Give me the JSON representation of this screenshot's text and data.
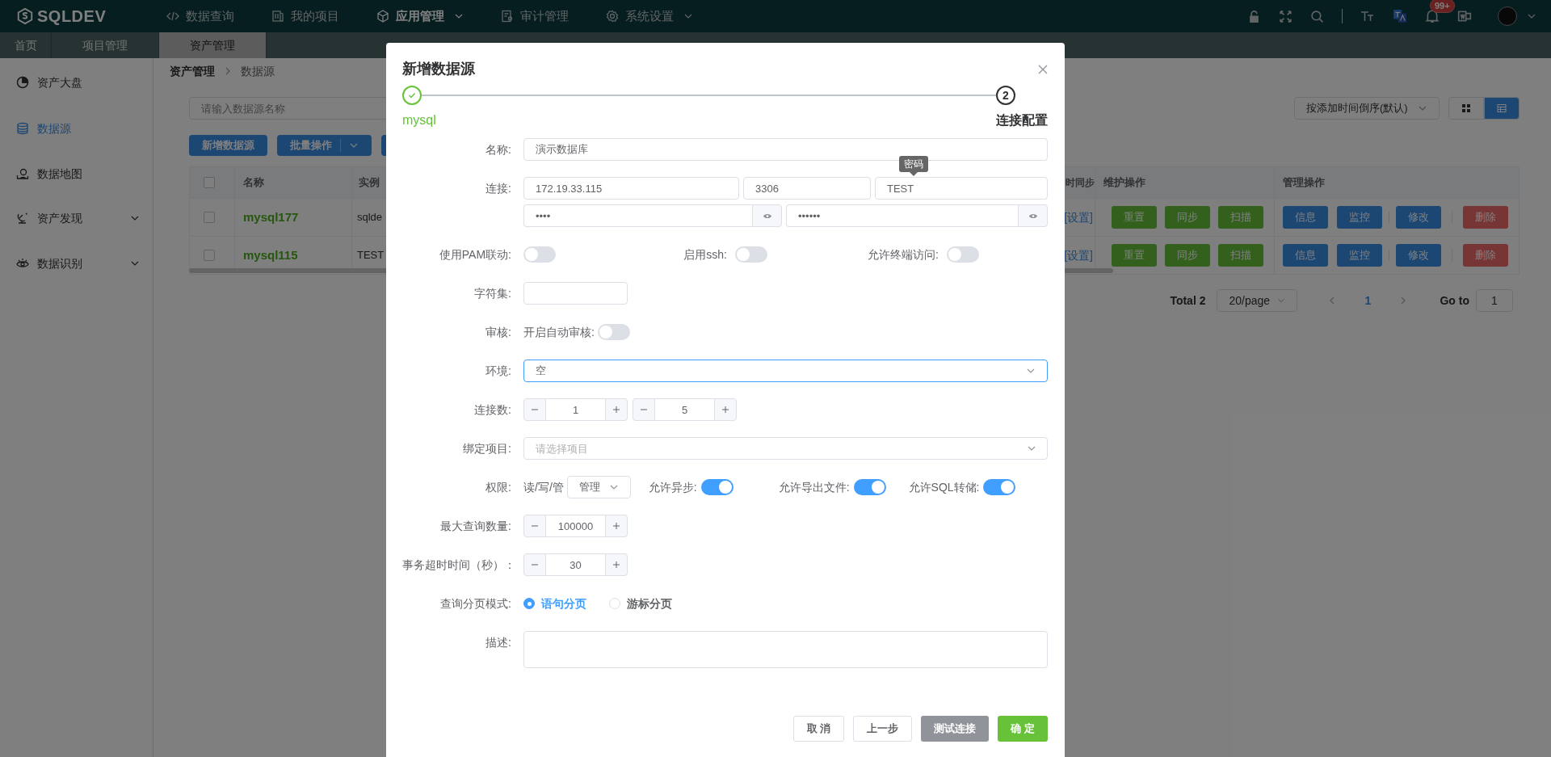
{
  "top_nav": {
    "logo": "SQLDEV",
    "items": [
      {
        "label": "数据查询",
        "selected": false,
        "dropdown": false
      },
      {
        "label": "我的项目",
        "selected": false,
        "dropdown": false
      },
      {
        "label": "应用管理",
        "selected": true,
        "dropdown": true
      },
      {
        "label": "审计管理",
        "selected": false,
        "dropdown": false
      },
      {
        "label": "系统设置",
        "selected": false,
        "dropdown": true
      }
    ],
    "notification_badge": "99+"
  },
  "tabs": [
    {
      "label": "首页",
      "selected": false
    },
    {
      "label": "项目管理",
      "selected": false
    },
    {
      "label": "资产管理",
      "selected": true
    }
  ],
  "sidebar": {
    "items": [
      {
        "label": "资产大盘",
        "selected": false,
        "submenu": false
      },
      {
        "label": "数据源",
        "selected": true,
        "submenu": false
      },
      {
        "label": "数据地图",
        "selected": false,
        "submenu": false
      },
      {
        "label": "资产发现",
        "selected": false,
        "submenu": true
      },
      {
        "label": "数据识别",
        "selected": false,
        "submenu": true
      }
    ]
  },
  "breadcrumb": [
    "资产管理",
    "数据源"
  ],
  "search": {
    "placeholder": "请输入数据源名称"
  },
  "toolbar": [
    {
      "label": "新增数据源",
      "dropdown": false
    },
    {
      "label": "批量操作",
      "dropdown": true
    }
  ],
  "sort_select": {
    "value": "按添加时间倒序(默认)"
  },
  "view_toggle": [
    {
      "kind": "grid",
      "selected": false
    },
    {
      "kind": "table",
      "selected": true
    }
  ],
  "table": {
    "all_checked": false,
    "columns": [
      "名称",
      "实例",
      "时同步",
      "维护操作",
      "管理操作"
    ],
    "rows": [
      {
        "checked": false,
        "name": "mysql177",
        "instance": "sqlde",
        "sync_link": "[设置]",
        "maintenance": [
          {
            "label": "重置",
            "kind": "success"
          },
          {
            "label": "同步",
            "kind": "success"
          },
          {
            "label": "扫描",
            "kind": "success"
          }
        ],
        "management": [
          {
            "label": "信息",
            "kind": "primary"
          },
          {
            "label": "监控",
            "kind": "primary"
          },
          {
            "label": "修改",
            "kind": "primary"
          },
          {
            "label": "删除",
            "kind": "danger"
          }
        ]
      },
      {
        "checked": false,
        "name": "mysql115",
        "instance": "TEST",
        "sync_link": "[设置]",
        "maintenance": [
          {
            "label": "重置",
            "kind": "success"
          },
          {
            "label": "同步",
            "kind": "success"
          },
          {
            "label": "扫描",
            "kind": "success"
          }
        ],
        "management": [
          {
            "label": "信息",
            "kind": "primary"
          },
          {
            "label": "监控",
            "kind": "primary"
          },
          {
            "label": "修改",
            "kind": "primary"
          },
          {
            "label": "删除",
            "kind": "danger"
          }
        ]
      }
    ]
  },
  "pagination": {
    "total": "Total 2",
    "page_size": "20/page",
    "pages": [
      {
        "label": "1",
        "selected": true
      }
    ],
    "goto_label": "Go to",
    "goto_value": "1"
  },
  "dialog": {
    "title": "新增数据源",
    "steps": [
      {
        "label": "mysql",
        "completed": true
      },
      {
        "label": "连接配置",
        "completed": false,
        "number": "2"
      }
    ],
    "tooltip": "密码",
    "form": [
      {
        "kind": "input",
        "label": "名称:",
        "value": "演示数据库"
      },
      {
        "kind": "connection",
        "label": "连接:",
        "host": "172.19.33.115",
        "port": "3306",
        "database": "TEST",
        "user": "••••",
        "password": "••••••"
      },
      {
        "kind": "switches",
        "items": [
          {
            "label": "使用PAM联动:",
            "on": false
          },
          {
            "label": "启用ssh:",
            "on": false
          },
          {
            "label": "允许终端访问:",
            "on": false
          }
        ]
      },
      {
        "kind": "short_input",
        "label": "字符集:"
      },
      {
        "kind": "switch_text",
        "label": "审核:",
        "text": "开启自动审核:",
        "on": false
      },
      {
        "kind": "select",
        "label": "环境:",
        "value": "空",
        "focused": true
      },
      {
        "kind": "number_pair",
        "label": "连接数:",
        "values": [
          "1",
          "5"
        ]
      },
      {
        "kind": "select",
        "label": "绑定项目:",
        "placeholder": "请选择项目",
        "focused": false
      },
      {
        "kind": "permissions",
        "label": "权限:",
        "text": "读/写/管",
        "select": "管理",
        "switches": [
          {
            "label": "允许异步:",
            "on": true
          },
          {
            "label": "允许导出文件:",
            "on": true
          },
          {
            "label": "允许SQL转储:",
            "on": true
          }
        ]
      },
      {
        "kind": "number",
        "label": "最大查询数量:",
        "value": "100000"
      },
      {
        "kind": "number",
        "label": "事务超时时间（秒）：",
        "value": "30"
      },
      {
        "kind": "radio",
        "label": "查询分页模式:",
        "options": [
          {
            "label": "语句分页",
            "selected": true
          },
          {
            "label": "游标分页",
            "selected": false
          }
        ]
      },
      {
        "kind": "textarea",
        "label": "描述:"
      }
    ],
    "buttons": [
      {
        "label": "取 消",
        "kind": "default"
      },
      {
        "label": "上一步",
        "kind": "default"
      },
      {
        "label": "测试连接",
        "kind": "info"
      },
      {
        "label": "确 定",
        "kind": "success"
      }
    ]
  }
}
